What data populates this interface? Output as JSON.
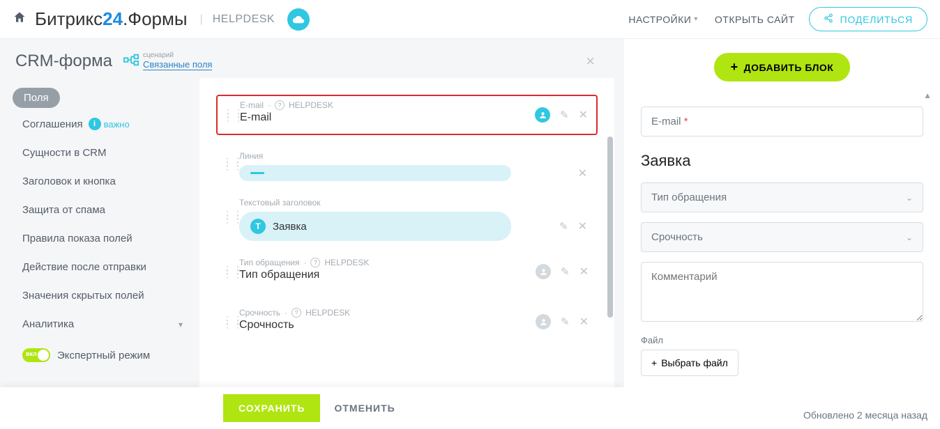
{
  "header": {
    "logo_brand": "Битрикс",
    "logo_num": "24",
    "logo_suffix": ".Формы",
    "breadcrumb": "HELPDESK",
    "nav_settings": "НАСТРОЙКИ",
    "nav_open_site": "ОТКРЫТЬ САЙТ",
    "share": "ПОДЕЛИТЬСЯ"
  },
  "left_header": {
    "title": "CRM-форма",
    "scenario_label": "сценарий",
    "scenario_value": "Связанные поля"
  },
  "sidebar": {
    "items": [
      {
        "label": "Поля",
        "active": true
      },
      {
        "label": "Соглашения",
        "important_badge": "важно"
      },
      {
        "label": "Сущности в CRM"
      },
      {
        "label": "Заголовок и кнопка"
      },
      {
        "label": "Защита от спама"
      },
      {
        "label": "Правила показа полей"
      },
      {
        "label": "Действие после отправки"
      },
      {
        "label": "Значения скрытых полей"
      },
      {
        "label": "Аналитика",
        "has_caret": true
      }
    ],
    "expert_label": "Экспертный режим",
    "expert_on": true
  },
  "editor_cards": [
    {
      "id": "email",
      "meta_name": "E-mail",
      "meta_hint": true,
      "meta_source": "HELPDESK",
      "value": "E-mail",
      "highlighted": true,
      "person": "blue",
      "edit": true,
      "close": true
    },
    {
      "id": "line",
      "meta_name": "Линия",
      "pill_type": "line",
      "close_outside": true
    },
    {
      "id": "heading",
      "meta_name": "Текстовый заголовок",
      "pill_type": "text",
      "pill_text": "Заявка",
      "edit": true,
      "close": true
    },
    {
      "id": "type",
      "meta_name": "Тип обращения",
      "meta_hint": true,
      "meta_source": "HELPDESK",
      "value": "Тип обращения",
      "person": "grey",
      "edit": true,
      "close": true
    },
    {
      "id": "urgency",
      "meta_name": "Срочность",
      "meta_hint": true,
      "meta_source": "HELPDESK",
      "value": "Срочность",
      "person": "grey",
      "edit": true,
      "close": true
    }
  ],
  "footer": {
    "save": "СОХРАНИТЬ",
    "cancel": "ОТМЕНИТЬ"
  },
  "preview": {
    "add_block": "ДОБАВИТЬ БЛОК",
    "email_label": "E-mail",
    "section_title": "Заявка",
    "select_type": "Тип обращения",
    "select_urgency": "Срочность",
    "comment_placeholder": "Комментарий",
    "file_label": "Файл",
    "file_button": "Выбрать файл",
    "updated_toast": "Обновлено 2 месяца назад"
  }
}
